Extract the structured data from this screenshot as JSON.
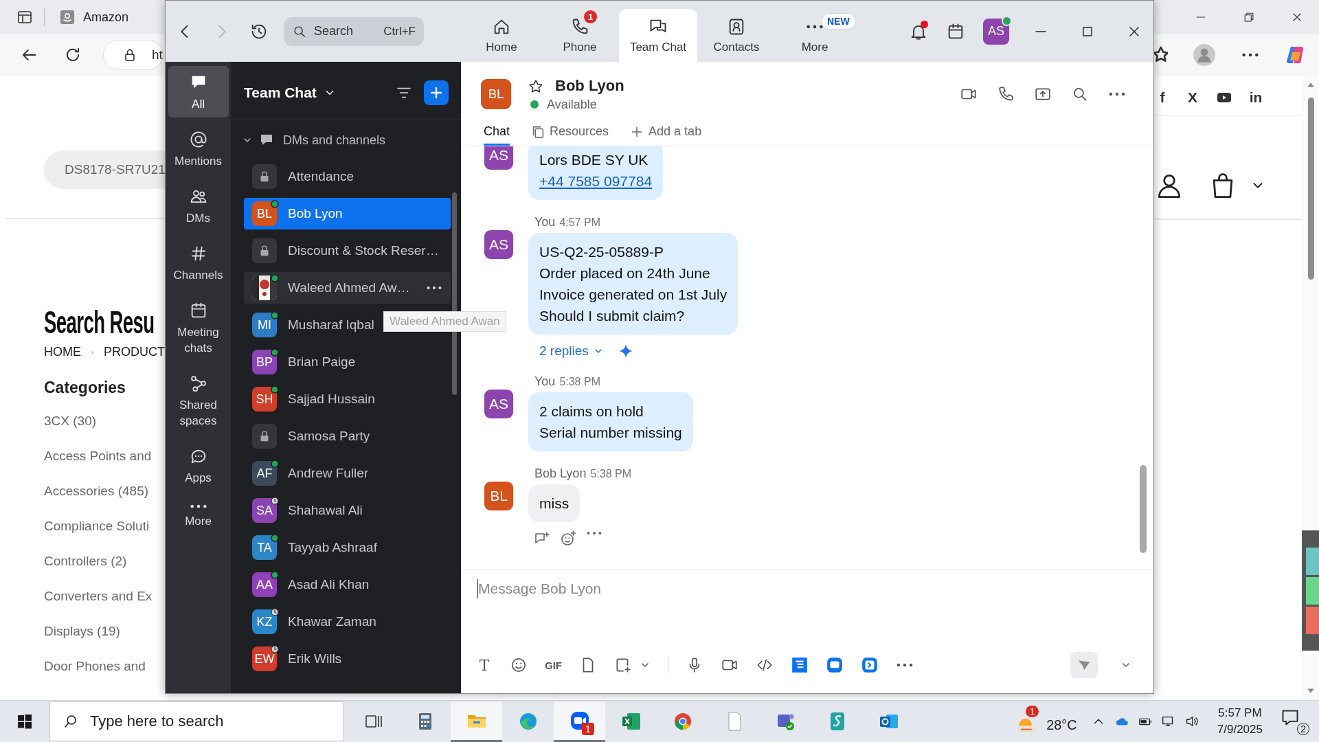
{
  "browser": {
    "tab_title": "Amazon",
    "address": "ht",
    "search_value": "DS8178-SR7U21",
    "heading": "Search Resu",
    "breadcrumb": [
      "HOME",
      "PRODUCT"
    ],
    "categories_title": "Categories",
    "categories": [
      "3CX (30)",
      "Access Points and",
      "Accessories (485)",
      "Compliance Soluti",
      "Controllers (2)",
      "Converters and Ex",
      "Displays (19)",
      "Door Phones and"
    ],
    "social": [
      {
        "kind": "text",
        "label": "f"
      },
      {
        "kind": "text",
        "label": "X"
      },
      {
        "kind": "video"
      },
      {
        "kind": "text",
        "label": "in"
      }
    ]
  },
  "zoom": {
    "nav": {
      "search_placeholder": "Search",
      "search_shortcut": "Ctrl+F",
      "forward_enabled": false,
      "tabs": [
        {
          "label": "Home",
          "selected": false
        },
        {
          "label": "Phone",
          "badge": "1",
          "selected": false
        },
        {
          "label": "Team Chat",
          "selected": true
        },
        {
          "label": "Contacts",
          "selected": false
        },
        {
          "label": "More",
          "tag": "NEW",
          "selected": false
        }
      ],
      "bell_dot": true,
      "avatar": "AS"
    },
    "rail": [
      {
        "label": "All",
        "selected": true
      },
      {
        "label": "Mentions",
        "selected": false
      },
      {
        "label": "DMs",
        "selected": false
      },
      {
        "label": "Channels",
        "selected": false
      },
      {
        "label": "Meeting chats",
        "selected": false
      },
      {
        "label": "Shared spaces",
        "selected": false
      },
      {
        "label": "Apps",
        "selected": false
      },
      {
        "label": "More",
        "selected": false
      }
    ],
    "list": {
      "title": "Team Chat",
      "section": "DMs and channels",
      "section_expanded": true,
      "tooltip": "Waleed Ahmed Awan",
      "items": [
        {
          "name": "Attendance",
          "kind": "channel",
          "selected": false,
          "hovered": false
        },
        {
          "name": "Bob Lyon",
          "kind": "person",
          "initials": "BL",
          "color": "#d4521c",
          "away": false,
          "selected": true,
          "hovered": false
        },
        {
          "name": "Discount & Stock Reser…",
          "kind": "channel",
          "selected": false,
          "hovered": false
        },
        {
          "name": "Waleed Ahmed Aw…",
          "away": false,
          "selected": false,
          "hovered": true
        },
        {
          "name": "Musharaf Iqbal",
          "kind": "person",
          "initials": "MI",
          "color": "#2d7dc5",
          "away": false,
          "selected": false,
          "hovered": false
        },
        {
          "name": "Brian Paige",
          "kind": "person",
          "initials": "BP",
          "color": "#8a44b3",
          "away": false,
          "selected": false,
          "hovered": false
        },
        {
          "name": "Sajjad Hussain",
          "kind": "person",
          "initials": "SH",
          "color": "#cf3f2a",
          "away": false,
          "selected": false,
          "hovered": false
        },
        {
          "name": "Samosa Party",
          "kind": "channel",
          "selected": false,
          "hovered": false
        },
        {
          "name": "Andrew Fuller",
          "kind": "person",
          "initials": "AF",
          "color": "#3c4a5c",
          "away": false,
          "selected": false,
          "hovered": false
        },
        {
          "name": "Shahawal Ali",
          "kind": "person",
          "initials": "SA",
          "color": "#8a44b3",
          "away": true,
          "selected": false,
          "hovered": false
        },
        {
          "name": "Tayyab Ashraaf",
          "kind": "person",
          "initials": "TA",
          "color": "#2d85c5",
          "away": false,
          "selected": false,
          "hovered": false
        },
        {
          "name": "Asad Ali Khan",
          "kind": "person",
          "initials": "AA",
          "color": "#9040b8",
          "away": false,
          "selected": false,
          "hovered": false
        },
        {
          "name": "Khawar Zaman",
          "kind": "person",
          "initials": "KZ",
          "color": "#2a88c8",
          "away": true,
          "selected": false,
          "hovered": false
        },
        {
          "name": "Erik Wills",
          "kind": "person",
          "initials": "EW",
          "color": "#d23c2c",
          "away": true,
          "selected": false,
          "hovered": false
        }
      ]
    },
    "chat": {
      "name": "Bob Lyon",
      "initials": "BL",
      "color": "#d4521c",
      "starred": false,
      "status": "Available",
      "tabs": [
        {
          "label": "Chat",
          "selected": true
        },
        {
          "label": "Resources",
          "selected": false
        }
      ],
      "add_tab": "Add a tab",
      "messages": [
        {
          "initials": "AS",
          "color": "#8e44ad",
          "mine": true,
          "lines": [
            "Lors BDE SY UK"
          ],
          "link": "+44 7585 097784"
        },
        {
          "initials": "AS",
          "color": "#8e44ad",
          "mine": true,
          "sender": "You",
          "time": "4:57 PM",
          "lines": [
            "US-Q2-25-05889-P",
            "Order placed on 24th June",
            "Invoice generated on 1st July",
            "Should I submit claim?"
          ],
          "replies": "2 replies",
          "summary": true
        },
        {
          "initials": "AS",
          "color": "#8e44ad",
          "mine": true,
          "sender": "You",
          "time": "5:38 PM",
          "lines": [
            "2 claims on hold",
            "Serial number missing"
          ]
        },
        {
          "initials": "BL",
          "color": "#d4521c",
          "mine": false,
          "sender": "Bob Lyon",
          "time": "5:38 PM",
          "lines": [
            "miss"
          ],
          "actions": true
        }
      ],
      "composer": {
        "placeholder": "Message Bob Lyon",
        "format_label": "T",
        "gif_label": "GIF",
        "send_enabled": false
      }
    }
  },
  "taskbar": {
    "search_placeholder": "Type here to search",
    "apps": [
      {
        "kind": "taskview",
        "active": false
      },
      {
        "kind": "calculator",
        "active": false
      },
      {
        "kind": "folder",
        "active": true
      },
      {
        "kind": "browser",
        "active": false
      },
      {
        "kind": "meeting",
        "active": true,
        "badge": "1"
      },
      {
        "kind": "spreadsheet",
        "active": false
      },
      {
        "kind": "globe",
        "active": false
      },
      {
        "kind": "notepad",
        "active": false
      },
      {
        "kind": "teams",
        "active": false
      },
      {
        "kind": "wave",
        "active": false
      },
      {
        "kind": "mail",
        "active": false
      }
    ],
    "weather": {
      "temp": "28°C",
      "badge": "1"
    },
    "time": "5:57 PM",
    "date": "7/9/2025",
    "notifications": "2"
  }
}
